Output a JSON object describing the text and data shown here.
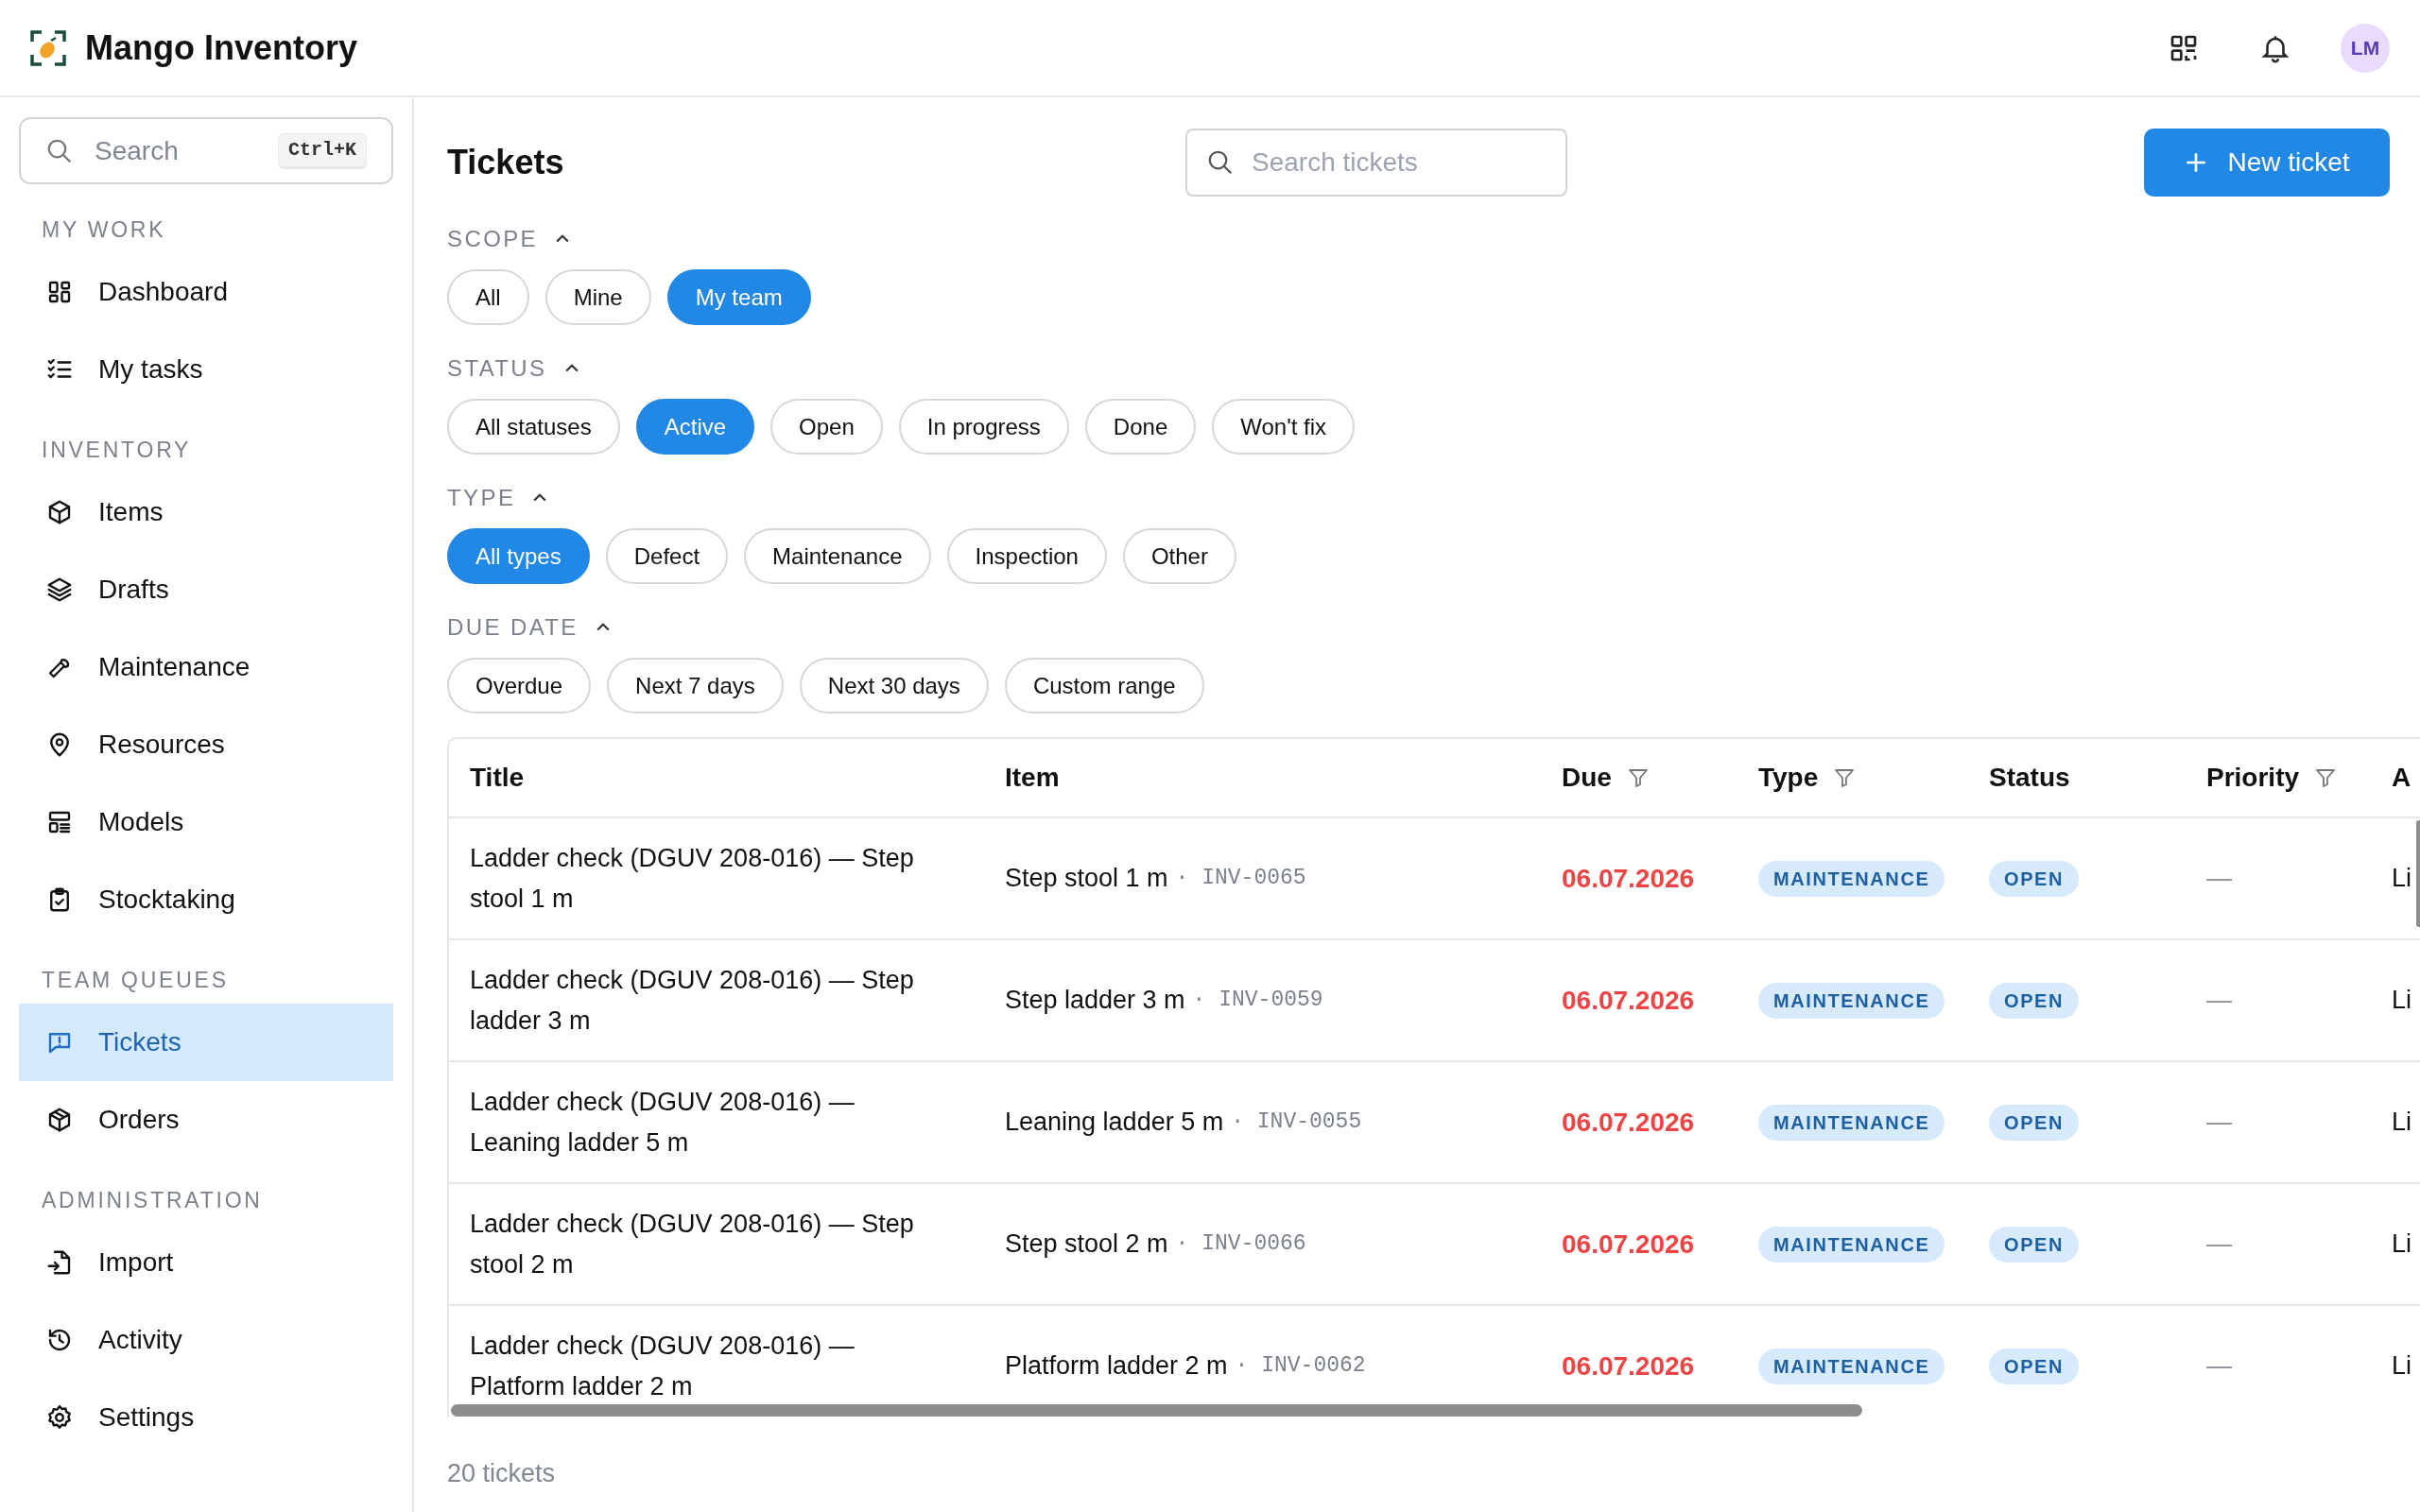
{
  "app": {
    "title": "Mango Inventory"
  },
  "header": {
    "avatar_initials": "LM"
  },
  "sidebar": {
    "search": {
      "placeholder": "Search",
      "shortcut": "Ctrl+K"
    },
    "sections": [
      {
        "label": "MY WORK",
        "items": [
          {
            "label": "Dashboard",
            "selected": false
          },
          {
            "label": "My tasks",
            "selected": false
          }
        ]
      },
      {
        "label": "INVENTORY",
        "items": [
          {
            "label": "Items",
            "selected": false
          },
          {
            "label": "Drafts",
            "selected": false
          },
          {
            "label": "Maintenance",
            "selected": false
          },
          {
            "label": "Resources",
            "selected": false
          },
          {
            "label": "Models",
            "selected": false
          },
          {
            "label": "Stocktaking",
            "selected": false
          }
        ]
      },
      {
        "label": "TEAM QUEUES",
        "items": [
          {
            "label": "Tickets",
            "selected": true
          },
          {
            "label": "Orders",
            "selected": false
          }
        ]
      },
      {
        "label": "ADMINISTRATION",
        "items": [
          {
            "label": "Import",
            "selected": false
          },
          {
            "label": "Activity",
            "selected": false
          },
          {
            "label": "Settings",
            "selected": false
          }
        ]
      }
    ]
  },
  "page": {
    "title": "Tickets",
    "search": {
      "placeholder": "Search tickets"
    },
    "new_button": "New ticket"
  },
  "filters": [
    {
      "label": "SCOPE",
      "expanded": true,
      "options": [
        {
          "label": "All",
          "selected": false
        },
        {
          "label": "Mine",
          "selected": false
        },
        {
          "label": "My team",
          "selected": true
        }
      ]
    },
    {
      "label": "STATUS",
      "expanded": true,
      "options": [
        {
          "label": "All statuses",
          "selected": false
        },
        {
          "label": "Active",
          "selected": true
        },
        {
          "label": "Open",
          "selected": false
        },
        {
          "label": "In progress",
          "selected": false
        },
        {
          "label": "Done",
          "selected": false
        },
        {
          "label": "Won't fix",
          "selected": false
        }
      ]
    },
    {
      "label": "TYPE",
      "expanded": true,
      "options": [
        {
          "label": "All types",
          "selected": true
        },
        {
          "label": "Defect",
          "selected": false
        },
        {
          "label": "Maintenance",
          "selected": false
        },
        {
          "label": "Inspection",
          "selected": false
        },
        {
          "label": "Other",
          "selected": false
        }
      ]
    },
    {
      "label": "DUE DATE",
      "expanded": true,
      "options": [
        {
          "label": "Overdue",
          "selected": false
        },
        {
          "label": "Next 7 days",
          "selected": false
        },
        {
          "label": "Next 30 days",
          "selected": false
        },
        {
          "label": "Custom range",
          "selected": false
        }
      ]
    }
  ],
  "table": {
    "columns": [
      {
        "label": "Title",
        "filter": false
      },
      {
        "label": "Item",
        "filter": false
      },
      {
        "label": "Due",
        "filter": true
      },
      {
        "label": "Type",
        "filter": true
      },
      {
        "label": "Status",
        "filter": false
      },
      {
        "label": "Priority",
        "filter": true
      },
      {
        "label": "A",
        "filter": false
      }
    ],
    "rows": [
      {
        "title": "Ladder check (DGUV 208-016) — Step stool 1 m",
        "item": "Step stool 1 m",
        "item_code": "· INV-0065",
        "due": "06.07.2026",
        "overdue": true,
        "type": "MAINTENANCE",
        "status": "OPEN",
        "priority": "—",
        "assignee": "Li"
      },
      {
        "title": "Ladder check (DGUV 208-016) — Step ladder 3 m",
        "item": "Step ladder 3 m",
        "item_code": "· INV-0059",
        "due": "06.07.2026",
        "overdue": true,
        "type": "MAINTENANCE",
        "status": "OPEN",
        "priority": "—",
        "assignee": "Li"
      },
      {
        "title": "Ladder check (DGUV 208-016) — Leaning ladder 5 m",
        "item": "Leaning ladder 5 m",
        "item_code": "· INV-0055",
        "due": "06.07.2026",
        "overdue": true,
        "type": "MAINTENANCE",
        "status": "OPEN",
        "priority": "—",
        "assignee": "Li"
      },
      {
        "title": "Ladder check (DGUV 208-016) — Step stool 2 m",
        "item": "Step stool 2 m",
        "item_code": "· INV-0066",
        "due": "06.07.2026",
        "overdue": true,
        "type": "MAINTENANCE",
        "status": "OPEN",
        "priority": "—",
        "assignee": "Li"
      },
      {
        "title": "Ladder check (DGUV 208-016) — Platform ladder 2 m",
        "item": "Platform ladder 2 m",
        "item_code": "· INV-0062",
        "due": "06.07.2026",
        "overdue": true,
        "type": "MAINTENANCE",
        "status": "OPEN",
        "priority": "—",
        "assignee": "Li"
      }
    ]
  },
  "footer": {
    "count": "20 tickets"
  }
}
